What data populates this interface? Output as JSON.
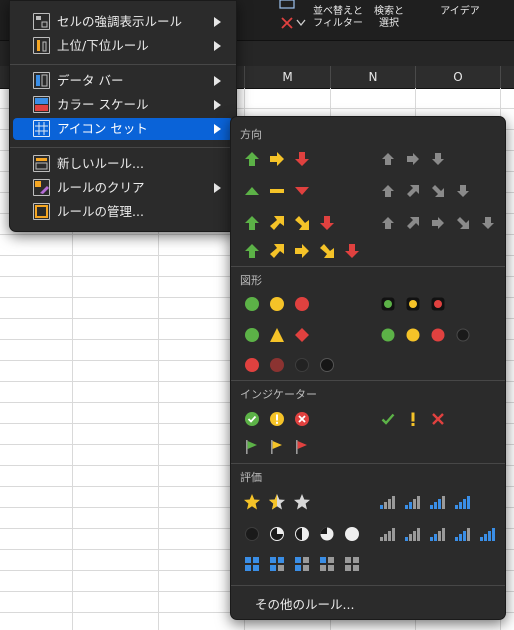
{
  "ribbon": {
    "sort_filter_label": "並べ替えと\nフィルター",
    "find_select_label": "検索と\n選択",
    "ideas_label": "アイデア"
  },
  "columns": [
    "",
    "",
    "",
    "M",
    "N",
    "O"
  ],
  "menu": {
    "items": [
      {
        "label": "セルの強調表示ルール",
        "submenu": true
      },
      {
        "label": "上位/下位ルール",
        "submenu": true
      },
      {
        "label": "データ バー",
        "submenu": true
      },
      {
        "label": "カラー スケール",
        "submenu": true
      },
      {
        "label": "アイコン セット",
        "submenu": true,
        "selected": true
      },
      {
        "label": "新しいルール...",
        "submenu": false
      },
      {
        "label": "ルールのクリア",
        "submenu": true
      },
      {
        "label": "ルールの管理...",
        "submenu": false
      }
    ]
  },
  "icon_sets": {
    "sections": [
      {
        "title": "方向"
      },
      {
        "title": "図形"
      },
      {
        "title": "インジケーター"
      },
      {
        "title": "評価"
      }
    ],
    "more_rules": "その他のルール..."
  },
  "colors": {
    "accent": "#0a63d8",
    "green": "#5cb247",
    "yellow": "#f5c328",
    "red": "#e0413f",
    "gray": "#8a8a8a",
    "blue": "#3a8ee6"
  }
}
